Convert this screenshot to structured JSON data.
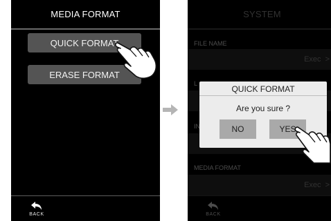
{
  "left_screen": {
    "title": "MEDIA FORMAT",
    "buttons": [
      {
        "label": "QUICK FORMAT"
      },
      {
        "label": "ERASE FORMAT"
      }
    ],
    "back_label": "BACK"
  },
  "right_screen": {
    "title": "SYSTEM",
    "rows": [
      {
        "label": "FILE NAME",
        "value": "Exec"
      },
      {
        "label": "L",
        "value": ""
      },
      {
        "label": "IN",
        "value": ""
      },
      {
        "label": "MEDIA FORMAT",
        "value": "Exec"
      }
    ],
    "back_label": "BACK",
    "dialog": {
      "title": "QUICK FORMAT",
      "message": "Are you sure ?",
      "no_label": "NO",
      "yes_label": "YES"
    }
  },
  "colors": {
    "screen_bg": "#000000",
    "button_bg": "#545454",
    "dialog_bg": "#ececec",
    "dialog_button_bg": "#a9a9a9",
    "arrow": "#b5b5b5"
  },
  "icons": [
    "back-arrow-icon",
    "pointing-hand-icon",
    "right-arrow-icon",
    "chevron-right-icon"
  ]
}
